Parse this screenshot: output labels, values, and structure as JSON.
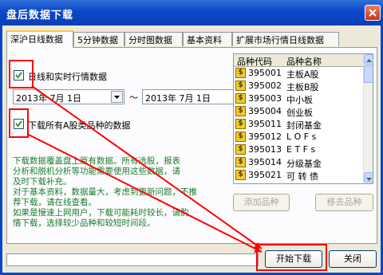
{
  "window": {
    "title": "盘后数据下载"
  },
  "tabs": [
    {
      "label": "深沪日线数据",
      "active": true
    },
    {
      "label": "5分钟数据"
    },
    {
      "label": "分时图数据"
    },
    {
      "label": "基本资料"
    },
    {
      "label": "扩展市场行情日线数据"
    }
  ],
  "options": {
    "daily_realtime": {
      "label": "日线和实时行情数据",
      "checked": true
    },
    "download_all_a": {
      "label": "下载所有A股类品种的数据",
      "checked": true
    }
  },
  "date_range": {
    "start": "2013年 7月 1日",
    "separator": "～",
    "end": "2013年 7月 1日"
  },
  "info_text": [
    "下载数据覆盖盘上原有数据。所有选股，报表",
    "分析和脱机分析等功能需要使用这些数据，请",
    "及时下载补充。",
    "对于基本资料，数据量大，考虑到更新问题，不推",
    "荐下载，请在线查看。",
    "如果是慢速上网用户，下载可能耗时较长，请酌",
    "情下载，选择较少品种和较短时间段。"
  ],
  "variety_table": {
    "headers": [
      "品种代码",
      "品种名称"
    ],
    "icon": "dollar-icon",
    "rows": [
      {
        "code": "395001",
        "name": "主板A股"
      },
      {
        "code": "395002",
        "name": "主板B股"
      },
      {
        "code": "395003",
        "name": "中小板"
      },
      {
        "code": "395004",
        "name": "创业板"
      },
      {
        "code": "395011",
        "name": "封闭基金"
      },
      {
        "code": "395012",
        "name": "L O F s"
      },
      {
        "code": "395013",
        "name": "E T F s"
      },
      {
        "code": "395014",
        "name": "分级基金"
      },
      {
        "code": "395021",
        "name": "可 转 债"
      }
    ]
  },
  "buttons": {
    "add_variety": "添加品种",
    "remove_variety": "移去品种",
    "start_download": "开始下载",
    "close": "关闭"
  },
  "colors": {
    "title_bar": "#0a47c9",
    "annotation": "#ff0000",
    "info_text": "#1d7a2e",
    "tab_highlight": "#ffc83c"
  }
}
